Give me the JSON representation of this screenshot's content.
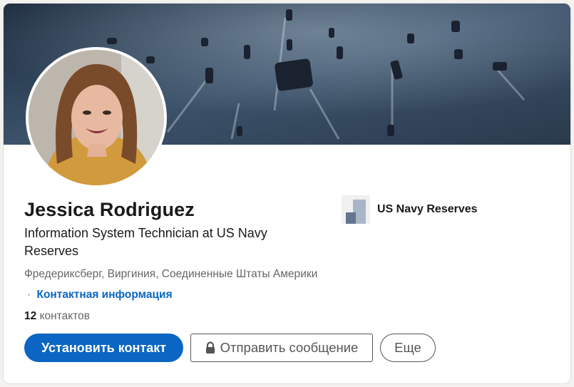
{
  "profile": {
    "name": "Jessica Rodriguez",
    "headline": "Information System Technician at US Navy Reserves",
    "location": "Фредериксберг, Виргиния, Соединенные Штаты Америки",
    "separator": "·",
    "contact_info_label": "Контактная информация",
    "connections_count": "12",
    "connections_label": "контактов"
  },
  "company": {
    "name": "US Navy Reserves"
  },
  "actions": {
    "connect_label": "Установить контакт",
    "message_label": "Отправить сообщение",
    "more_label": "Еще"
  },
  "colors": {
    "accent": "#0a66c2",
    "text_primary": "#191919",
    "text_secondary": "#666666"
  },
  "icons": {
    "message_button_icon": "lock-icon"
  }
}
